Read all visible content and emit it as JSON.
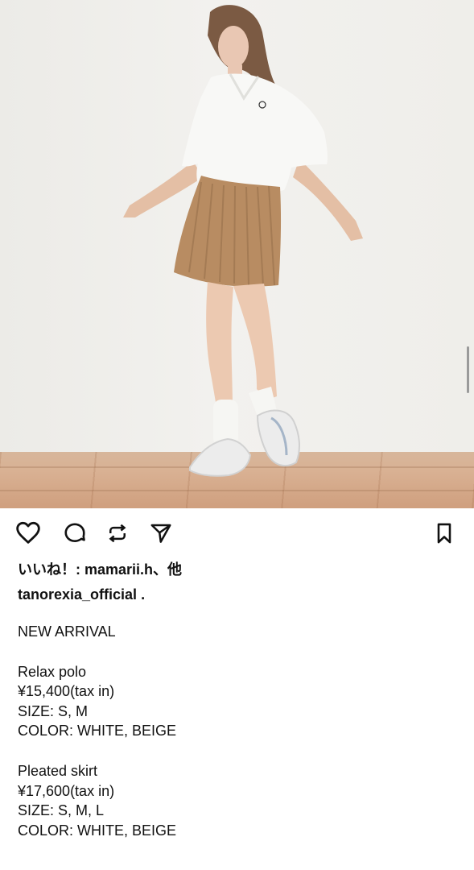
{
  "post": {
    "likes_text": "いいね！: mamarii.h、他",
    "username": "tanorexia_official",
    "username_suffix": " .",
    "caption": {
      "headline": "NEW ARRIVAL",
      "products": [
        {
          "name": "Relax polo",
          "price": "¥15,400(tax in)",
          "size": "SIZE: S, M",
          "color": "COLOR: WHITE, BEIGE"
        },
        {
          "name": "Pleated skirt",
          "price": "¥17,600(tax in)",
          "size": "SIZE: S, M, L",
          "color": "COLOR: WHITE, BEIGE"
        }
      ]
    }
  },
  "icons": {
    "like": "heart-icon",
    "comment": "comment-icon",
    "repost": "repost-icon",
    "share": "send-icon",
    "save": "bookmark-icon"
  },
  "colors": {
    "wall": "#efeeea",
    "floor": "#d6ac8c",
    "shirt": "#f8f8f6",
    "skirt": "#b88c62",
    "text": "#111111"
  }
}
